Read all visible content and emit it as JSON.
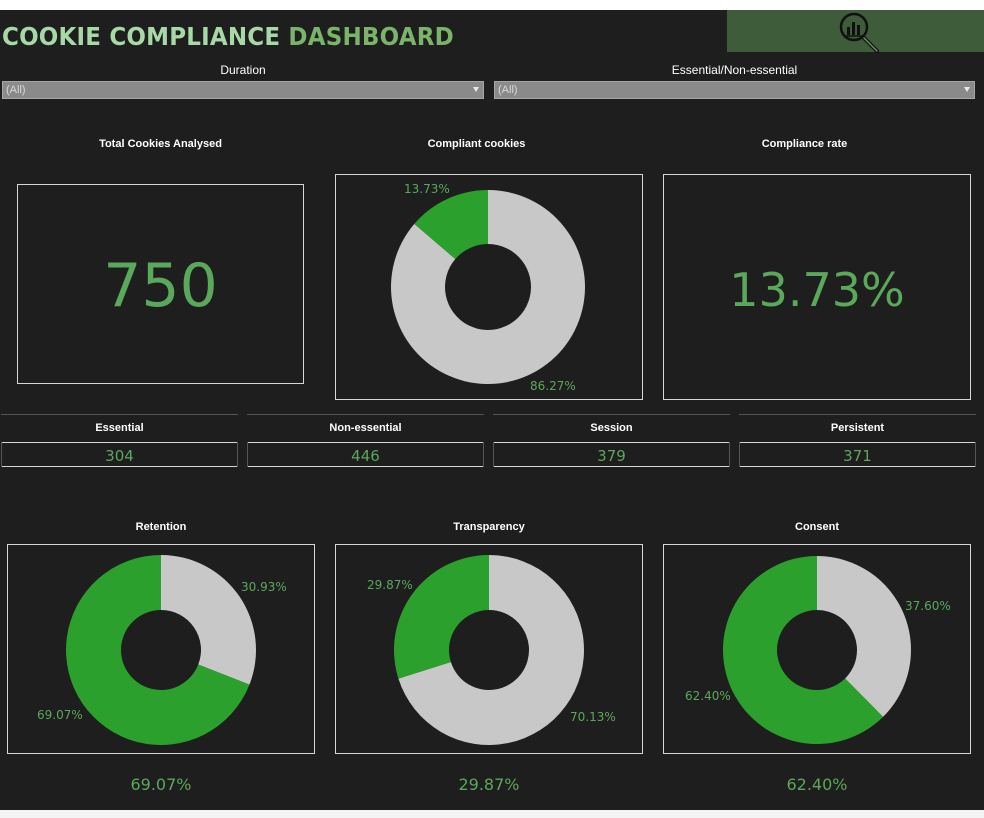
{
  "header": {
    "title_part1": "COOKIE COMPLIANCE ",
    "title_part2": "DASHBOARD",
    "logo_icon": "magnifier-chart-icon",
    "logo_color": "#3e5c3a"
  },
  "filters": [
    {
      "label": "Duration",
      "value": "(All)"
    },
    {
      "label": "Essential/Non-essential",
      "value": "(All)"
    }
  ],
  "kpis": {
    "total": {
      "title": "Total Cookies Analysed",
      "value": "750"
    },
    "compliant": {
      "title": "Compliant cookies"
    },
    "rate": {
      "title": "Compliance rate",
      "value": "13.73%"
    }
  },
  "stats": [
    {
      "label": "Essential",
      "value": "304"
    },
    {
      "label": "Non-essential",
      "value": "446"
    },
    {
      "label": "Session",
      "value": "379"
    },
    {
      "label": "Persistent",
      "value": "371"
    }
  ],
  "colors": {
    "compliant": "#2ca02c",
    "non_compliant": "#c8c8c8",
    "background": "#1e1e1e",
    "accent_text": "#5aa85a"
  },
  "chart_data": [
    {
      "type": "pie",
      "title": "Compliant cookies",
      "slices": [
        {
          "label": "13.73%",
          "value": 13.73,
          "color": "#2ca02c"
        },
        {
          "label": "86.27%",
          "value": 86.27,
          "color": "#c8c8c8"
        }
      ]
    },
    {
      "type": "pie",
      "title": "Retention",
      "summary": "69.07%",
      "slices": [
        {
          "label": "30.93%",
          "value": 30.93,
          "color": "#c8c8c8"
        },
        {
          "label": "69.07%",
          "value": 69.07,
          "color": "#2ca02c"
        }
      ]
    },
    {
      "type": "pie",
      "title": "Transparency",
      "summary": "29.87%",
      "slices": [
        {
          "label": "70.13%",
          "value": 70.13,
          "color": "#c8c8c8"
        },
        {
          "label": "29.87%",
          "value": 29.87,
          "color": "#2ca02c"
        }
      ]
    },
    {
      "type": "pie",
      "title": "Consent",
      "summary": "62.40%",
      "slices": [
        {
          "label": "37.60%",
          "value": 37.6,
          "color": "#c8c8c8"
        },
        {
          "label": "62.40%",
          "value": 62.4,
          "color": "#2ca02c"
        }
      ]
    }
  ]
}
